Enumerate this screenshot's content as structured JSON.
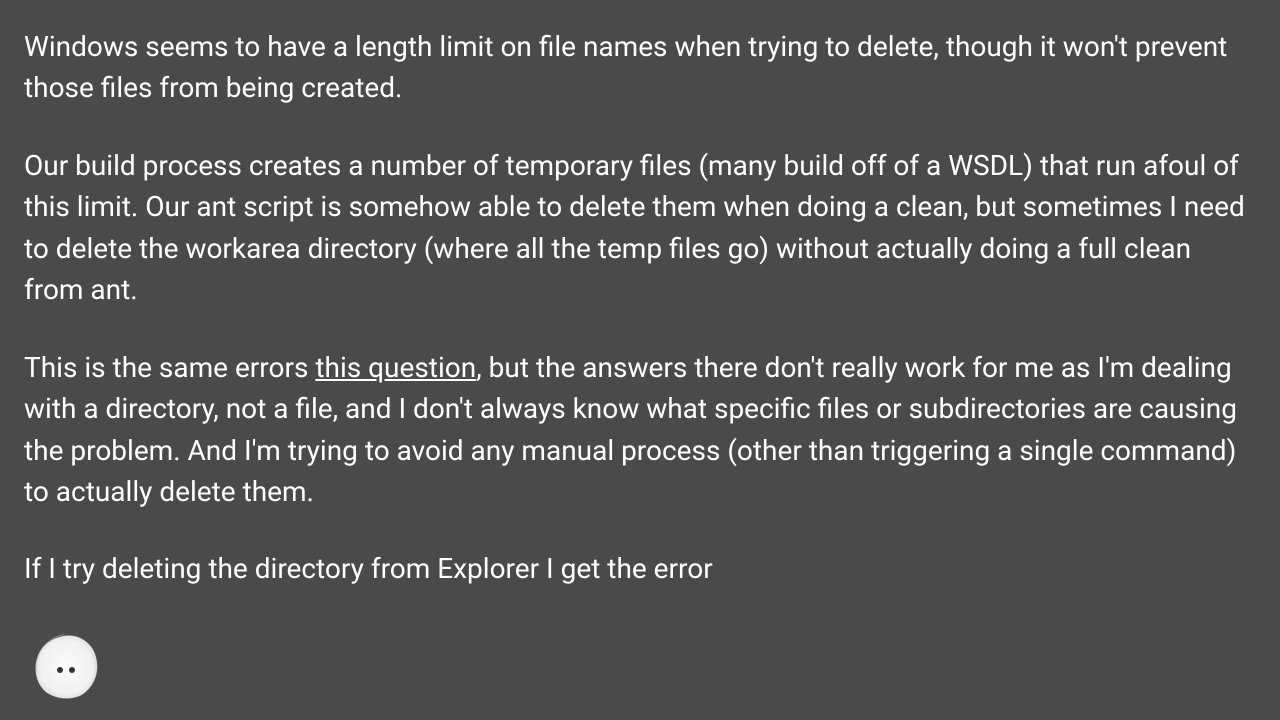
{
  "paragraphs": {
    "p1": "Windows seems to have a length limit on file names when trying to delete, though it won't prevent those files from being created.",
    "p2": "Our build process creates a number of temporary files (many build off of a WSDL) that run afoul of this limit. Our ant script is somehow able to delete them when doing a clean, but sometimes I need to delete the workarea directory (where all the temp files go) without actually doing a full clean from ant.",
    "p3_before": "This is the same errors ",
    "p3_link": "this question",
    "p3_after": ", but the answers there don't really work for me as I'm dealing with a directory, not a file, and I don't always know what specific files or subdirectories are causing the problem. And I'm trying to avoid any manual process (other than triggering a single command) to actually delete them.",
    "p4": "If I try deleting the directory from Explorer I get the error"
  }
}
